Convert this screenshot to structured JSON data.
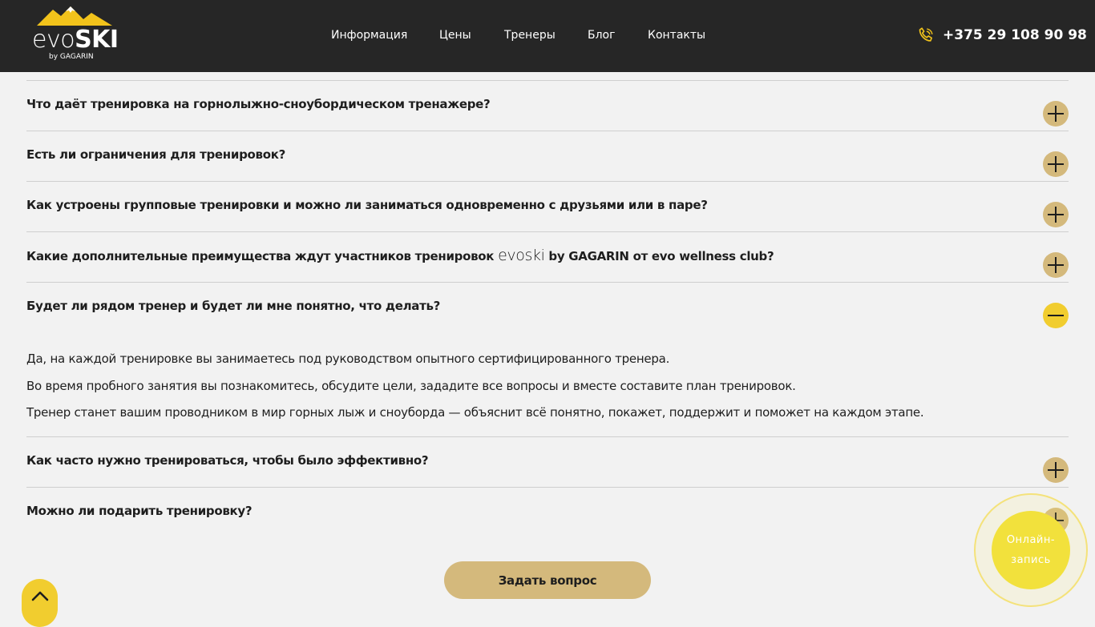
{
  "header": {
    "logo": {
      "brand_light": "evo",
      "brand_bold": "SKI",
      "tagline": "by GAGARIN"
    },
    "nav": [
      {
        "label": "Информация"
      },
      {
        "label": "Цены"
      },
      {
        "label": "Тренеры"
      },
      {
        "label": "Блог"
      },
      {
        "label": "Контакты"
      }
    ],
    "phone": "+375 29 108 90 98",
    "phone_icon": "phone-icon"
  },
  "faq": {
    "items": [
      {
        "question": "Что даёт тренировка на горнолыжно-сноубордическом тренажере?",
        "state": "collapsed"
      },
      {
        "question": "Есть ли ограничения для тренировок?",
        "state": "collapsed"
      },
      {
        "question": "Как устроены групповые тренировки и можно ли заниматься одновременно с друзьями или в паре?",
        "state": "collapsed"
      },
      {
        "question_before": "Какие дополнительные преимущества ждут участников тренировок",
        "question_brand": "evoski",
        "question_after": "by GAGARIN от evo wellness club?",
        "state": "collapsed"
      },
      {
        "question": "Будет ли рядом тренер и будет ли мне понятно, что делать?",
        "state": "expanded"
      },
      {
        "question": "Как часто нужно тренироваться, чтобы было эффективно?",
        "state": "collapsed"
      },
      {
        "question": "Можно ли подарить тренировку?",
        "state": "collapsed"
      }
    ],
    "open_answer": [
      "Да, на каждой тренировке вы занимаетесь под руководством опытного сертифицированного тренера.",
      "Во время пробного занятия вы познакомитесь, обсудите цели, зададите все вопросы и вместе составите план тренировок.",
      "Тренер станет вашим проводником в мир горных лыж и сноуборда — объяснит всё понятно, покажет, поддержит и поможет на каждом этапе."
    ],
    "icons": {
      "collapsed": "plus-icon",
      "expanded": "minus-icon"
    }
  },
  "ask_button": {
    "label": "Задать вопрос"
  },
  "scroll_top": {
    "icon": "chevron-up-icon"
  },
  "online_booking": {
    "line1": "Онлайн-",
    "line2": "запись"
  },
  "colors": {
    "header_bg": "#262626",
    "page_bg": "#f2f2f2",
    "accent_gold": "#d4b97c",
    "accent_yellow": "#f1cd2f",
    "logo_yellow": "#f2c31b"
  }
}
